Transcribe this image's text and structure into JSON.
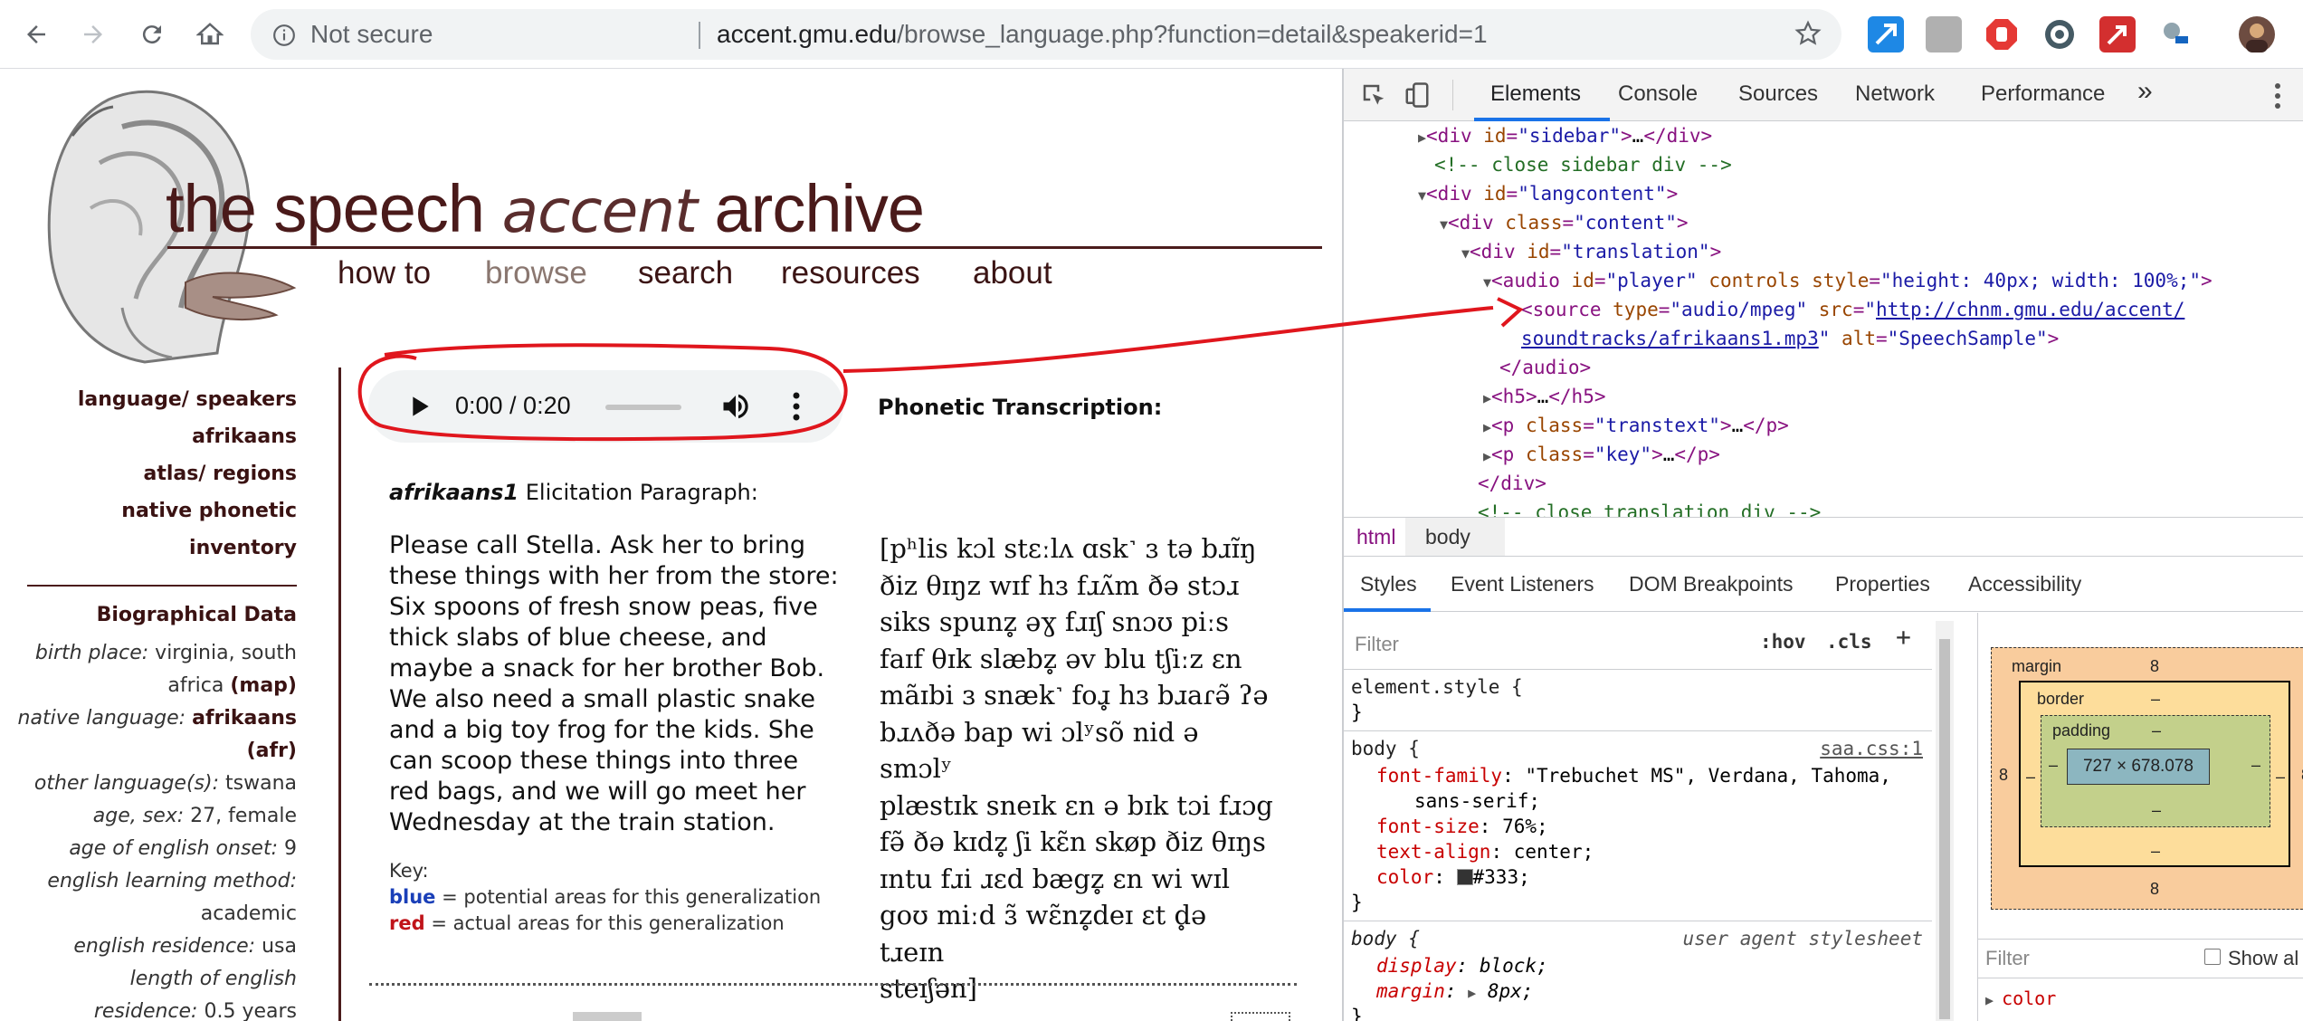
{
  "browser": {
    "security_label": "Not secure",
    "url_host": "accent.gmu.edu",
    "url_path": "/browse_language.php?function=detail&speakerid=1"
  },
  "site": {
    "title_left": "the speech ",
    "title_mid": "accent",
    "title_right": " archive",
    "menu": [
      "how to",
      "browse",
      "search",
      "resources",
      "about"
    ]
  },
  "sidebar": {
    "links": [
      "language/ speakers",
      "afrikaans",
      "atlas/ regions",
      "native phonetic inventory"
    ],
    "bio_title": "Biographical Data",
    "bio": {
      "birth_place_label": "birth place:",
      "birth_place_value": "virginia, south",
      "birth_place_value2": "africa",
      "map_link": "(map)",
      "native_language_label": "native language:",
      "native_language_value": "afrikaans",
      "native_language_code": "(afr)",
      "other_languages_label": "other language(s):",
      "other_languages_value": "tswana",
      "age_sex_label": "age, sex:",
      "age_sex_value": "27, female",
      "onset_label": "age of english onset:",
      "onset_value": "9",
      "method_label": "english learning method:",
      "method_value": "academic",
      "residence_label": "english residence:",
      "residence_value": "usa",
      "length_label": "length of english",
      "length_label2": "residence:",
      "length_value": "0.5 years"
    }
  },
  "player": {
    "time": "0:00 / 0:20",
    "progress": 0
  },
  "content": {
    "elicitation_title_italic": "afrikaans1",
    "elicitation_title_rest": " Elicitation Paragraph:",
    "paragraph": "Please call Stella.  Ask her to bring these things with her from the store: Six spoons of fresh snow peas, five thick slabs of blue cheese, and maybe a snack for her brother Bob.  We also need a small plastic snake and a big toy frog for the kids.  She can scoop these things into three red bags, and we will go meet her Wednesday at the train station.",
    "key_label": "Key:",
    "key_blue_word": "blue",
    "key_blue_text": " = potential areas for this generalization",
    "key_red_word": "red",
    "key_red_text": " = actual areas for this generalization",
    "phonetic_title": "Phonetic Transcription:",
    "ipa_lines": [
      "[pʰlis kɔl stɛːlʌ ɑsk˺ ɜ tə bɹɪ̃ŋ",
      "ðiz θɪŋz wɪf hɜ fɹʌ̃m ðə stɔɹ",
      "siks spunz̥ əɣ fɹɪʃ snɔʊ piːs",
      "faɪf θɪk slæbz̥ əv blu tʃiːz ɛn",
      "mãɪbi ɜ snæk˺ foɹ̥ hɜ bɹaɾǝ̃ ʔə",
      "bɹʌðə bap wi ɔlʸsõ nid ə smɔlʸ",
      "plæstɪk sneɪk ɛn ə bɪk tɔi fɹɔg",
      "fə̃ ðə kɪdz̥ ʃi kɛ̃n skøp ðiz θɪŋs",
      "ɪntu fɹi ɹɛd bægz̥ ɛn wi wɪl",
      "goʊ miːd ɜ̃ wɛ̃nz̥deɪ ɛt d̥ə tɹeɪn",
      "steɪʃən]"
    ]
  },
  "devtools": {
    "tabs": [
      "Elements",
      "Console",
      "Sources",
      "Network",
      "Performance"
    ],
    "more": "»",
    "breadcrumbs": [
      "html",
      "body"
    ],
    "subtabs": [
      "Styles",
      "Event Listeners",
      "DOM Breakpoints",
      "Properties",
      "Accessibility"
    ],
    "filter_placeholder": "Filter",
    "hov": ":hov",
    "cls": ".cls",
    "plus": "+",
    "element_style": "element.style {",
    "close_brace": "}",
    "body_selector": "body {",
    "body_source": "saa.css:1",
    "font_family_prop": "font-family",
    "font_family_val": "\"Trebuchet MS\", Verdana, Tahoma,",
    "font_family_val2": "sans-serif;",
    "font_size_prop": "font-size",
    "font_size_val": "76%;",
    "text_align_prop": "text-align",
    "text_align_val": "center;",
    "color_prop": "color",
    "color_val": "#333;",
    "ua_selector": "body {",
    "ua_label": "user agent stylesheet",
    "display_prop": "display",
    "display_val": "block;",
    "margin_prop": "margin",
    "margin_val": "8px;",
    "box": {
      "margin_label": "margin",
      "border_label": "border",
      "padding_label": "padding",
      "margin_val": "8",
      "dash": "–",
      "content": "727 × 678.078"
    },
    "bm_filter": "Filter",
    "show_all": "Show al",
    "color_partial": "color"
  }
}
